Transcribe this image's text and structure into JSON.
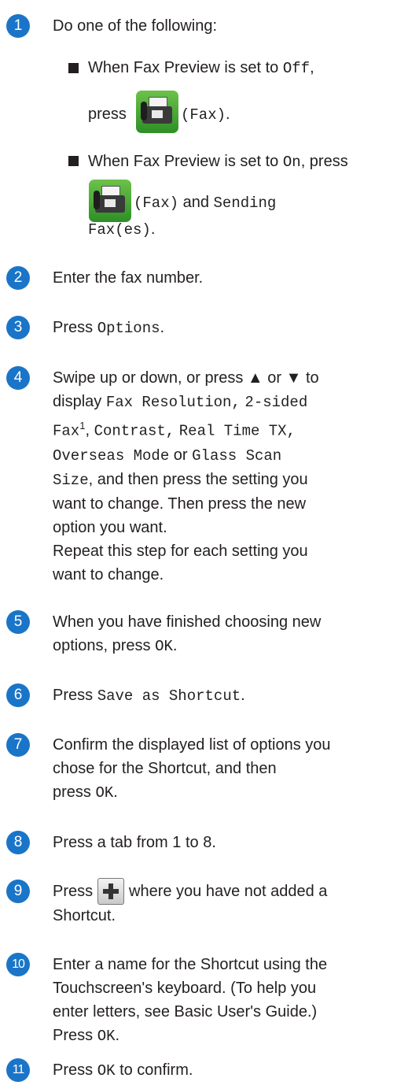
{
  "steps": [
    {
      "num": "1",
      "intro": "Do one of the following:",
      "b1_l1": "When Fax Preview is set to",
      "b1_off": "Off",
      "b1_l2a": "press",
      "b1_fax": "(Fax)",
      "b2_l1": "When Fax Preview is set to",
      "b2_on": "On",
      "b2_press": ", press",
      "b2_fax": "(Fax)",
      "b2_and": "and",
      "b2_sending": "Sending",
      "b2_faxes": "Fax(es)"
    },
    {
      "num": "2",
      "text": "Enter the fax number."
    },
    {
      "num": "3",
      "press": "Press",
      "options": "Options"
    },
    {
      "num": "4",
      "l1": "Swipe up or down, or press ▲ or ▼ to",
      "l2a": "display",
      "fax_res": "Fax Resolution,",
      "two_sided": "2-sided",
      "fax": "Fax",
      "sup": "1",
      "contrast": "Contrast,",
      "real_time": "Real Time TX,",
      "overseas": "Overseas Mode",
      "or": "or",
      "glass": "Glass Scan",
      "size": "Size",
      "l4b": ", and then press the setting you",
      "l5": "want to change. Then press the new",
      "l6": "option you want.",
      "l7": "Repeat this step for each setting you",
      "l8": "want to change."
    },
    {
      "num": "5",
      "l1": "When you have finished choosing new",
      "l2": "options, press",
      "ok": "OK"
    },
    {
      "num": "6",
      "press": "Press",
      "save": "Save as Shortcut"
    },
    {
      "num": "7",
      "l1": "Confirm the displayed list of options you",
      "l2": "chose for the Shortcut, and then",
      "l3": "press",
      "ok": "OK"
    },
    {
      "num": "8",
      "text": "Press a tab from 1 to 8."
    },
    {
      "num": "9",
      "press": "Press",
      "l1b": "where you have not added a",
      "l2": "Shortcut."
    },
    {
      "num": "10",
      "l1": "Enter a name for the Shortcut using the",
      "l2": "Touchscreen's keyboard. (To help you",
      "l3": "enter letters, see Basic User's Guide.)",
      "l4": "Press",
      "ok": "OK"
    },
    {
      "num": "11",
      "press": "Press",
      "ok": "OK",
      "tail": "to confirm."
    }
  ],
  "icons": {
    "fax": "fax-machine-icon",
    "plus": "plus-icon"
  },
  "colors": {
    "step_circle": "#1a75c8"
  }
}
